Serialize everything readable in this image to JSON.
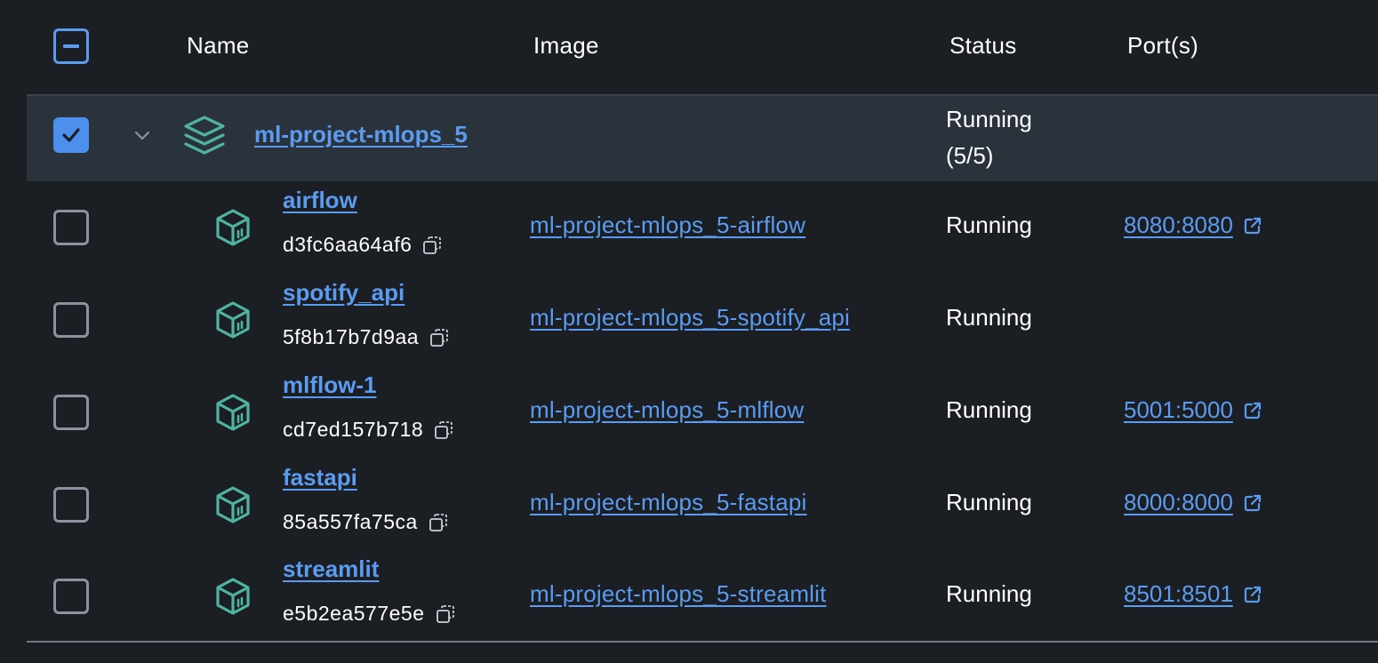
{
  "header": {
    "name": "Name",
    "image": "Image",
    "status": "Status",
    "ports": "Port(s)"
  },
  "group": {
    "name": "ml-project-mlops_5",
    "status_line1": "Running",
    "status_line2": "(5/5)",
    "icon": "stack-icon",
    "checked": true
  },
  "containers": [
    {
      "name": "airflow",
      "id": "d3fc6aa64af6",
      "image": "ml-project-mlops_5-airflow",
      "status": "Running",
      "port": "8080:8080"
    },
    {
      "name": "spotify_api",
      "id": "5f8b17b7d9aa",
      "image": "ml-project-mlops_5-spotify_api",
      "status": "Running",
      "port": ""
    },
    {
      "name": "mlflow-1",
      "id": "cd7ed157b718",
      "image": "ml-project-mlops_5-mlflow",
      "status": "Running",
      "port": "5001:5000"
    },
    {
      "name": "fastapi",
      "id": "85a557fa75ca",
      "image": "ml-project-mlops_5-fastapi",
      "status": "Running",
      "port": "8000:8000"
    },
    {
      "name": "streamlit",
      "id": "e5b2ea577e5e",
      "image": "ml-project-mlops_5-streamlit",
      "status": "Running",
      "port": "8501:8501"
    }
  ],
  "colors": {
    "background": "#1b1f23",
    "group_row": "#2a333b",
    "link": "#5b9bf0",
    "icon_teal": "#4fb3a0",
    "checkbox_checked": "#4c8fec"
  }
}
